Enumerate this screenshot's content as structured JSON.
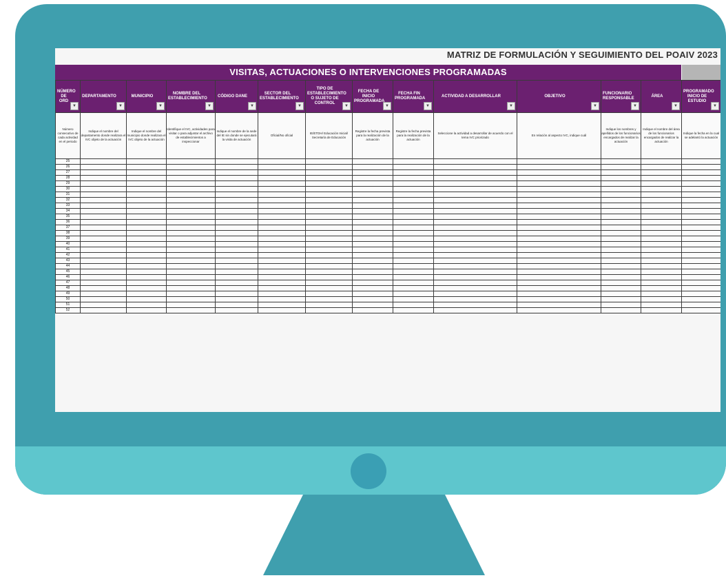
{
  "document": {
    "title": "MATRIZ DE FORMULACIÓN Y SEGUIMIENTO DEL POAIV 2023",
    "banner": "VISITAS, ACTUACIONES O INTERVENCIONES PROGRAMADAS"
  },
  "columns": [
    {
      "label": "NÚMERO DE ORD",
      "desc": "Número consecutivo de cada actividad en el periodo"
    },
    {
      "label": "DEPARTAMENTO",
      "desc": "Indique el nombre del departamento donde realizara el IVC objeto de la actuación"
    },
    {
      "label": "MUNICIPIO",
      "desc": "Indique el nombre del municipio donde realizara el IVC objeto de la actuación"
    },
    {
      "label": "NOMBRE DEL ESTABLECIMIENTO",
      "desc": "Identifique el IVC, actividades para visitar o para adjuntar el archivo de establecimientos a inspeccionar"
    },
    {
      "label": "CÓDIGO DANE",
      "desc": "Indique el nombre de la sede del IE sin donde se ejecutará la visita de actuación"
    },
    {
      "label": "SECTOR DEL ESTABLECIMIENTO",
      "desc": "Oficial/No oficial"
    },
    {
      "label": "TIPO DE ESTABLECIMIENTO O SUJETO DE CONTROL",
      "desc": "IE/ETDH/ Educación Inicial/ Secretaría de Educación"
    },
    {
      "label": "FECHA DE INICIO PROGRAMADA",
      "desc": "Registre la fecha prevista para la realización de la actuación"
    },
    {
      "label": "FECHA FIN PROGRAMADA",
      "desc": "Registre la fecha prevista para la realización de la actuación"
    },
    {
      "label": "ACTIVIDAD A DESARROLLAR",
      "desc": "Seleccione la actividad a desarrollar de acuerdo con el tema IVC priorizado"
    },
    {
      "label": "OBJETIVO",
      "desc": "En relación al aspecto IVC, indique cuál"
    },
    {
      "label": "FUNCIONARIO RESPONSABLE",
      "desc": "Indique los nombres y apellidos de los funcionarios encargados de realizar la actuación"
    },
    {
      "label": "ÁREA",
      "desc": "Indique el nombre del área de los funcionarios encargados de realizar la actuación"
    },
    {
      "label": "PROGRAMADO INICIO DE ESTUDIO",
      "desc": "Indique la fecha en la cual se adelantó la actuación"
    }
  ],
  "row_numbers": [
    "25",
    "26",
    "27",
    "28",
    "29",
    "30",
    "31",
    "32",
    "33",
    "34",
    "35",
    "36",
    "37",
    "38",
    "39",
    "40",
    "41",
    "42",
    "43",
    "44",
    "45",
    "46",
    "47",
    "48",
    "49",
    "50",
    "51",
    "52"
  ],
  "dropdown_icon": "filter-dropdown-icon"
}
